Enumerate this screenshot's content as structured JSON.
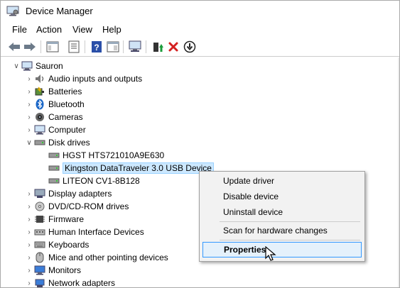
{
  "window": {
    "title": "Device Manager"
  },
  "menu": [
    "File",
    "Action",
    "View",
    "Help"
  ],
  "toolbar": {
    "icons": [
      "back-arrow-icon",
      "forward-arrow-icon",
      "show-hide-console-tree-icon",
      "properties-icon",
      "help-icon",
      "action-pane-icon",
      "scan-hardware-icon",
      "update-driver-icon",
      "uninstall-icon",
      "disable-device-icon"
    ]
  },
  "tree": {
    "root": "Sauron",
    "categories": [
      "Audio inputs and outputs",
      "Batteries",
      "Bluetooth",
      "Cameras",
      "Computer",
      "Disk drives",
      "Display adapters",
      "DVD/CD-ROM drives",
      "Firmware",
      "Human Interface Devices",
      "Keyboards",
      "Mice and other pointing devices",
      "Monitors",
      "Network adapters"
    ],
    "disk_drives": [
      "HGST HTS721010A9E630",
      "Kingston DataTraveler 3.0 USB Device",
      "LITEON CV1-8B128"
    ]
  },
  "context_menu": {
    "items": [
      "Update driver",
      "Disable device",
      "Uninstall device",
      "Scan for hardware changes",
      "Properties"
    ]
  },
  "colors": {
    "selection_bg": "#cce8ff",
    "hover_border": "#3399ff",
    "menu_bg": "#f2f2f2"
  }
}
